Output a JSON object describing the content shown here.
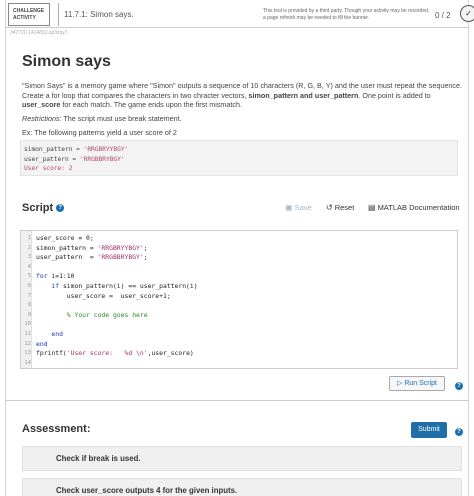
{
  "header": {
    "badge": "CHALLENGE ACTIVITY",
    "title": "11.7.1: Simon says.",
    "notice": "This tool is provided by a third party. Though your activity may be recorded, a page refresh may be needed to fill the banner.",
    "score": "0 / 2",
    "hash": "347720.1414812.qx3zqy7"
  },
  "problem": {
    "title": "Simon says",
    "description": "\"Simon Says\" is a memory game where \"Simon\" outputs a sequence of 10 characters (R, G, B, Y) and the user must repeat the sequence. Create a for loop that compares the characters in two chracter vectors, simon_pattern and user_pattern. One point is added to user_score for each match. The game ends upon the first mismatch.",
    "restrictions_label": "Restrictions:",
    "restrictions_text": " The script must use break statement.",
    "example_intro": "Ex: The following patterns yield a user score of 2",
    "sample": {
      "l1_lhs": "simon_pattern = ",
      "l1_val": "'RRGBRYYBGY'",
      "l2_lhs": "user_pattern  = ",
      "l2_val": "'RRGBBRYBGY'",
      "l3_lhs": "User score:  ",
      "l3_val": "2"
    }
  },
  "script": {
    "title": "Script",
    "save_label": "Save",
    "reset_label": "Reset",
    "doc_label": "MATLAB Documentation",
    "lines": [
      {
        "n": "1",
        "code": "user_score = 0;"
      },
      {
        "n": "2",
        "code": "simon_pattern = 'RRGBRYYBGY';"
      },
      {
        "n": "3",
        "code": "user_pattern  = 'RRGBBRYBGY';"
      },
      {
        "n": "4",
        "code": ""
      },
      {
        "n": "5",
        "code": "for i=1:10"
      },
      {
        "n": "6",
        "code": "    if simon_pattern(i) == user_pattern(i)"
      },
      {
        "n": "7",
        "code": "        user_score =  user_score+1;"
      },
      {
        "n": "8",
        "code": ""
      },
      {
        "n": "9",
        "code": "        % Your code goes here"
      },
      {
        "n": "10",
        "code": ""
      },
      {
        "n": "11",
        "code": "    end"
      },
      {
        "n": "12",
        "code": "end"
      },
      {
        "n": "13",
        "code": "fprintf('User score:   %d \\n',user_score)"
      },
      {
        "n": "14",
        "code": ""
      }
    ],
    "run_label": "Run Script"
  },
  "assessment": {
    "title": "Assessment:",
    "submit_label": "Submit",
    "checks": [
      "Check if break is used.",
      "Check user_score outputs 4 for the given inputs."
    ]
  },
  "colors": {
    "accent": "#1e6fa8",
    "keyword": "#1a34b8",
    "comment": "#2a8a2a",
    "string": "#a0306a"
  }
}
